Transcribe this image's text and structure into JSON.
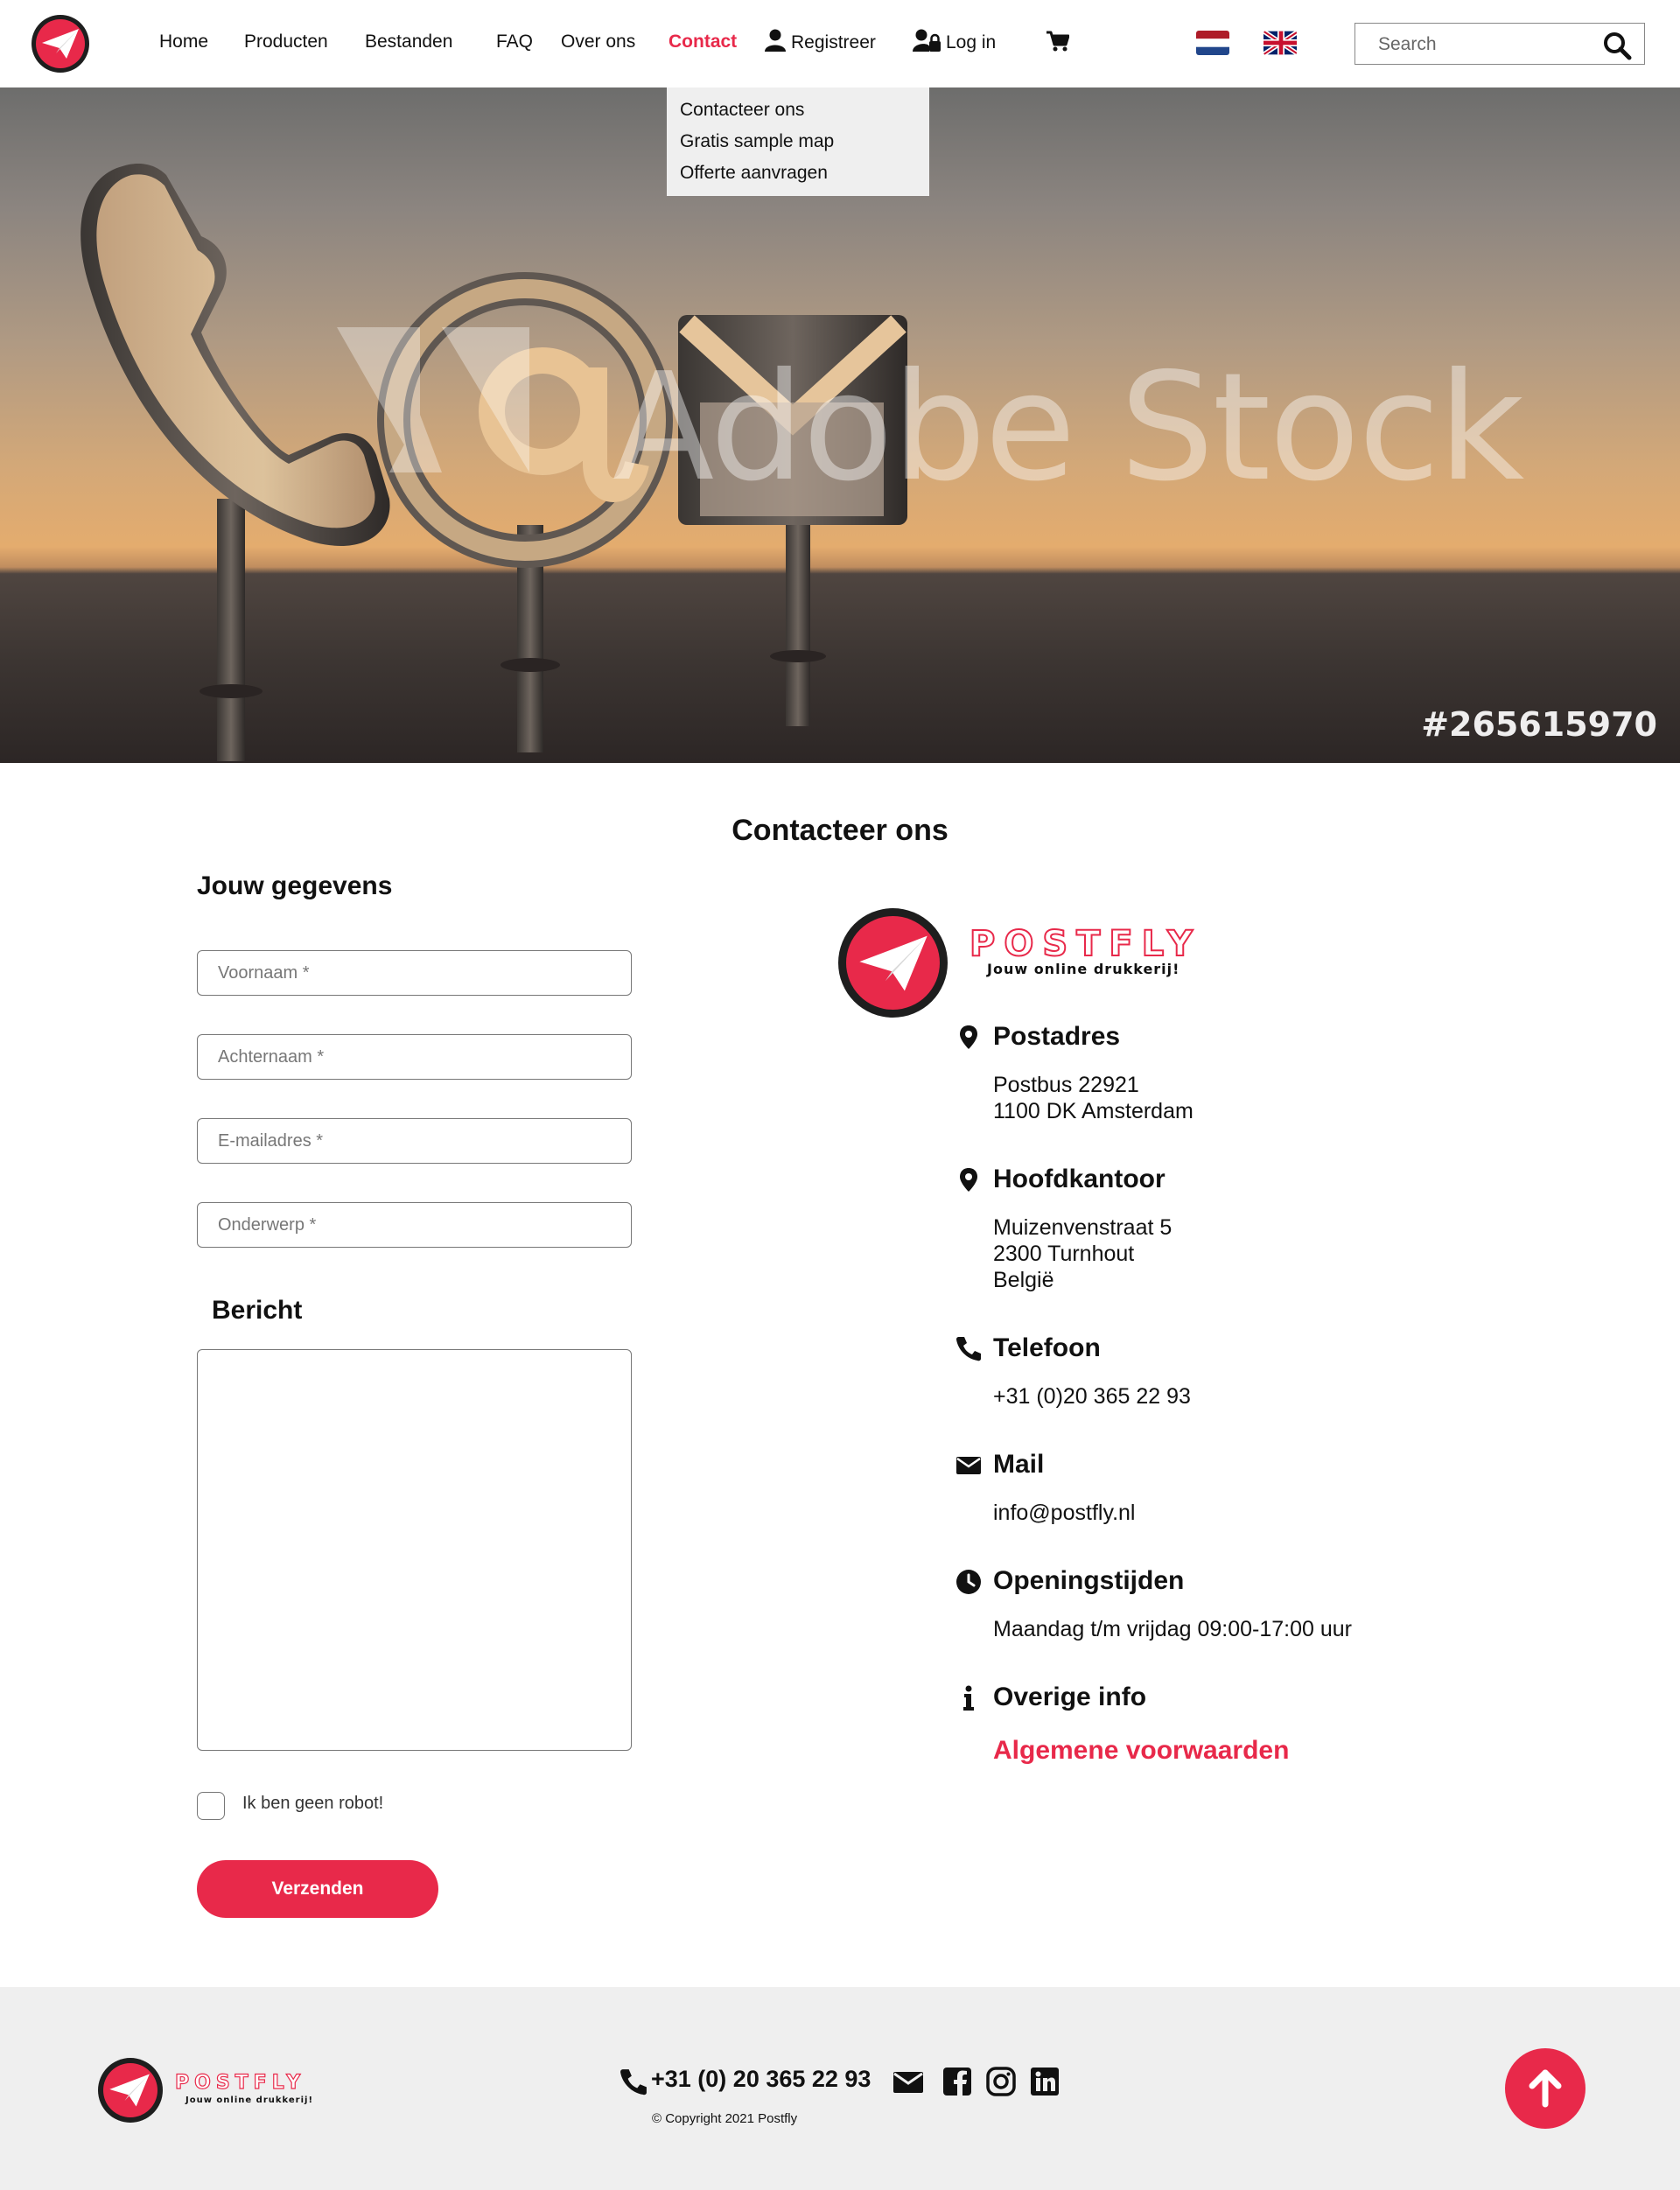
{
  "nav": {
    "items": [
      "Home",
      "Producten",
      "Bestanden",
      "FAQ",
      "Over ons",
      "Contact"
    ],
    "active": "Contact",
    "register_label": "Registreer",
    "login_label": "Log in",
    "search_placeholder": "Search"
  },
  "contact_menu": {
    "items": [
      "Contacteer ons",
      "Gratis sample map",
      "Offerte aanvragen"
    ]
  },
  "hero": {
    "watermark": "Adobe Stock",
    "image_id": "#265615970"
  },
  "page_title": "Contacteer ons",
  "form": {
    "section_title": "Jouw gegevens",
    "firstname_placeholder": "Voornaam *",
    "lastname_placeholder": "Achternaam *",
    "email_placeholder": "E-mailadres *",
    "subject_placeholder": "Onderwerp *",
    "message_title": "Bericht",
    "robot_label": "Ik ben geen robot!",
    "submit_label": "Verzenden"
  },
  "brand": {
    "name": "POSTFLY",
    "tagline": "Jouw online drukkerij!",
    "accent_color": "#e8294a"
  },
  "info": {
    "postal": {
      "heading": "Postadres",
      "lines": [
        "Postbus 22921",
        "1100 DK Amsterdam"
      ]
    },
    "office": {
      "heading": "Hoofdkantoor",
      "lines": [
        "Muizenvenstraat 5",
        "2300 Turnhout",
        "België"
      ]
    },
    "phone": {
      "heading": "Telefoon",
      "value": "+31 (0)20 365 22 93"
    },
    "mail": {
      "heading": "Mail",
      "value": "info@postfly.nl"
    },
    "hours": {
      "heading": "Openingstijden",
      "value": "Maandag t/m vrijdag 09:00-17:00 uur"
    },
    "other": {
      "heading": "Overige info",
      "link": "Algemene voorwaarden"
    }
  },
  "footer": {
    "phone": "+31 (0) 20 365 22 93",
    "copyright": "© Copyright 2021 Postfly",
    "social_icons": [
      "mail-icon",
      "facebook-icon",
      "instagram-icon",
      "linkedin-icon"
    ]
  }
}
